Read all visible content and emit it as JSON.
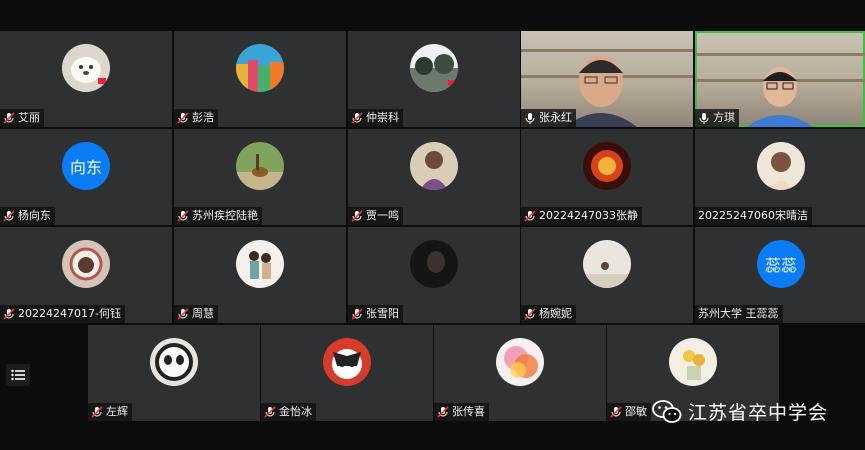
{
  "participants": [
    {
      "name": "艾丽",
      "muted": true
    },
    {
      "name": "彭浩",
      "muted": true
    },
    {
      "name": "仲崇科",
      "muted": true
    },
    {
      "name": "张永红",
      "muted": false,
      "video": true
    },
    {
      "name": "方琪",
      "muted": false,
      "video": true,
      "speaking": true
    },
    {
      "name": "杨向东",
      "muted": true,
      "avatar_text": "向东"
    },
    {
      "name": "苏州疾控陆艳",
      "muted": true
    },
    {
      "name": "贾一鸣",
      "muted": true
    },
    {
      "name": "20224247033张静",
      "muted": true
    },
    {
      "name": "20225247060宋晴洁",
      "muted": false
    },
    {
      "name": "20224247017-何钰",
      "muted": true
    },
    {
      "name": "周慧",
      "muted": true
    },
    {
      "name": "张雪阳",
      "muted": true
    },
    {
      "name": "杨婉妮",
      "muted": true
    },
    {
      "name": "苏州大学 王蕊蕊",
      "muted": false,
      "avatar_text": "蕊蕊"
    },
    {
      "name": "左辉",
      "muted": true
    },
    {
      "name": "金怡冰",
      "muted": true
    },
    {
      "name": "张传喜",
      "muted": true
    },
    {
      "name": "邵敏",
      "muted": true
    }
  ],
  "watermark": {
    "text": "江苏省卒中学会"
  },
  "colors": {
    "tile_bg": "#2f3032",
    "page_bg": "#0c0c0c",
    "avatar_blue": "#0a7cf5",
    "speaking_border": "#3fbf3f"
  },
  "icons": {
    "muted": "mic-off-icon",
    "unmuted": "mic-icon",
    "menu": "list-menu-icon",
    "wechat": "wechat-icon"
  }
}
